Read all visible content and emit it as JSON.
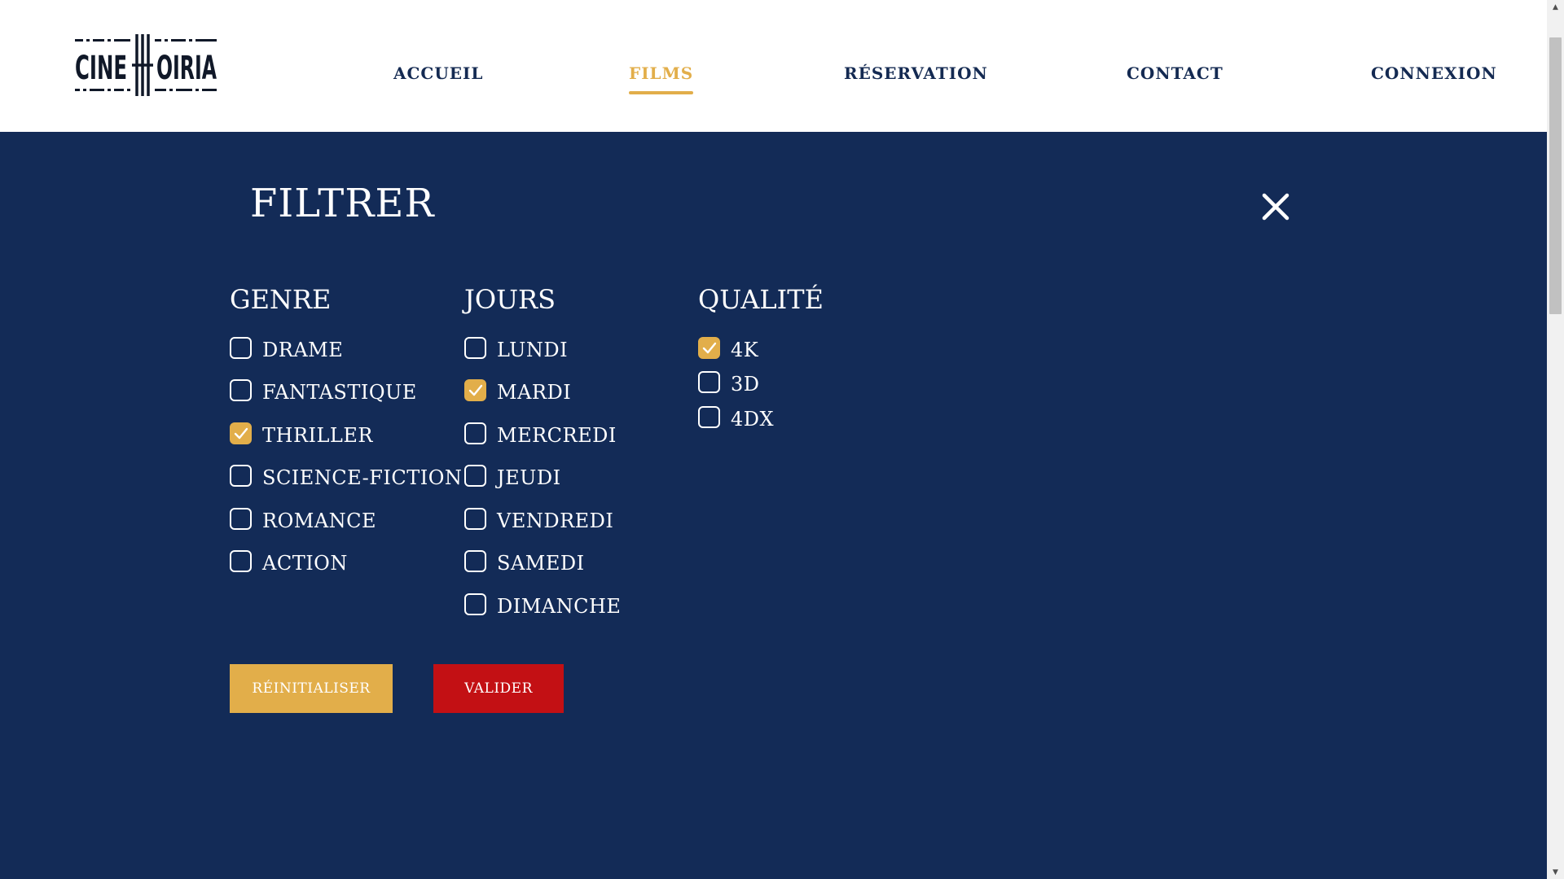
{
  "header": {
    "logo": {
      "text": "CINEHOIRIA"
    },
    "nav": [
      {
        "id": "accueil",
        "label": "ACCUEIL",
        "active": false
      },
      {
        "id": "films",
        "label": "FILMS",
        "active": true
      },
      {
        "id": "reservation",
        "label": "RÉSERVATION",
        "active": false
      },
      {
        "id": "contact",
        "label": "CONTACT",
        "active": false
      },
      {
        "id": "connexion",
        "label": "CONNEXION",
        "active": false
      }
    ]
  },
  "filter": {
    "title": "FILTRER",
    "close_icon": "close-icon",
    "columns": {
      "genre": {
        "title": "GENRE",
        "options": [
          {
            "label": "DRAME",
            "checked": false
          },
          {
            "label": "FANTASTIQUE",
            "checked": false
          },
          {
            "label": "THRILLER",
            "checked": true
          },
          {
            "label": "SCIENCE-FICTION",
            "checked": false
          },
          {
            "label": "ROMANCE",
            "checked": false
          },
          {
            "label": "ACTION",
            "checked": false
          }
        ]
      },
      "jours": {
        "title": "JOURS",
        "options": [
          {
            "label": "LUNDI",
            "checked": false
          },
          {
            "label": "MARDI",
            "checked": true
          },
          {
            "label": "MERCREDI",
            "checked": false
          },
          {
            "label": "JEUDI",
            "checked": false
          },
          {
            "label": "VENDREDI",
            "checked": false
          },
          {
            "label": "SAMEDI",
            "checked": false
          },
          {
            "label": "DIMANCHE",
            "checked": false
          }
        ]
      },
      "qualite": {
        "title": "QUALITÉ",
        "options": [
          {
            "label": "4K",
            "checked": true
          },
          {
            "label": "3D",
            "checked": false
          },
          {
            "label": "4DX",
            "checked": false
          }
        ]
      }
    },
    "buttons": {
      "reset_label": "RÉINITIALISER",
      "validate_label": "VALIDER"
    }
  },
  "colors": {
    "navy": "#132b57",
    "gold": "#e2ae4a",
    "red": "#c31014",
    "white": "#ffffff",
    "nav_text": "#142a52"
  }
}
